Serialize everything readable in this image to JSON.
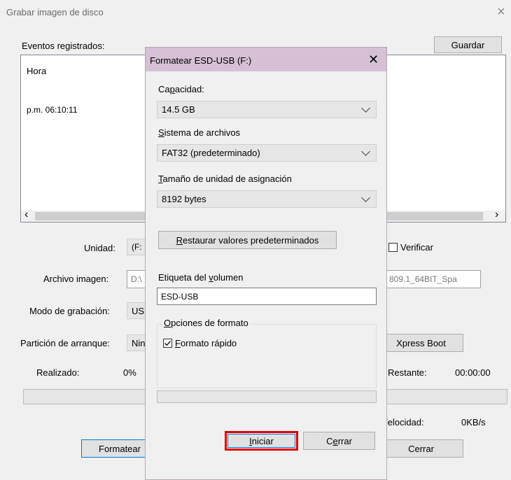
{
  "window": {
    "title": "Grabar imagen de disco",
    "close_glyph": "×"
  },
  "events": {
    "label": "Eventos registrados:",
    "save_button": "Guardar",
    "column_header": "Hora",
    "rows": [
      {
        "time": "p.m. 06:10:11"
      }
    ],
    "scroll_left": "‹",
    "scroll_right": "›"
  },
  "form": {
    "drive_label": "Unidad:",
    "drive_value": "(F:",
    "verify_label": "Verificar",
    "image_label": "Archivo imagen:",
    "image_value_left": "D:\\",
    "image_value_right": "809.1_64BIT_Spa",
    "write_mode_label": "Modo de grabación:",
    "write_mode_value": "US",
    "boot_partition_label": "Partición de arranque:",
    "boot_partition_value": "Nin",
    "xpress_boot_button": "Xpress Boot",
    "done_label": "Realizado:",
    "done_value": "0%",
    "remaining_label": "Restante:",
    "remaining_value": "00:00:00",
    "progress": 0,
    "speed_label": "/elocidad:",
    "speed_value": "0KB/s",
    "format_button": "Formatear",
    "close_button": "Cerrar"
  },
  "format_dialog": {
    "title": "Formatear ESD-USB (F:)",
    "close_glyph": "✕",
    "capacity_label": "Capacidad:",
    "capacity_value": "14.5 GB",
    "filesystem_label": "Sistema de archivos",
    "filesystem_value": "FAT32 (predeterminado)",
    "allocation_label": "Tamaño de unidad de asignación",
    "allocation_value": "8192 bytes",
    "restore_button": "Restaurar valores predeterminados",
    "volume_label_label": "Etiqueta del volumen",
    "volume_label_value": "ESD-USB",
    "options_group_label": "Opciones de formato",
    "quick_format_label": "Formato rápido",
    "quick_format_checked": true,
    "progress": 0,
    "start_button": "Iniciar",
    "close_button": "Cerrar",
    "highlight_color": "#e00000"
  }
}
